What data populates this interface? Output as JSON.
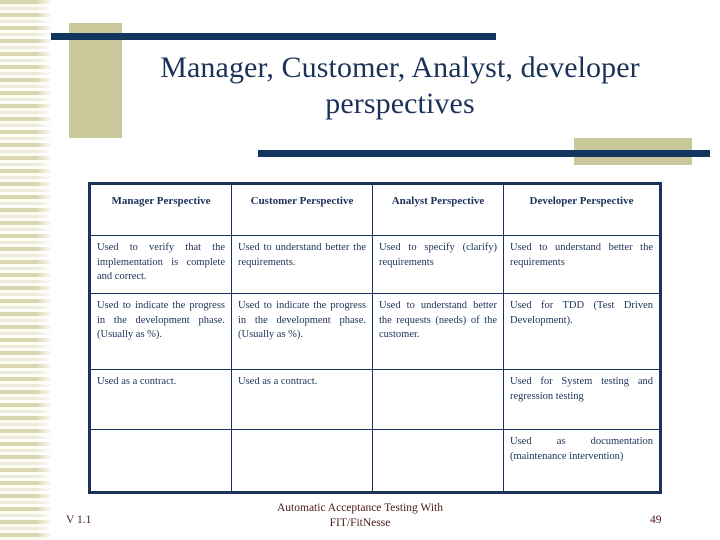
{
  "slide": {
    "title": "Manager, Customer, Analyst, developer perspectives",
    "colors": {
      "navy": "#1b3259",
      "navy_bar": "#12365f",
      "khaki": "#c8c89a",
      "footer_text": "#4a1b1b",
      "stripe_light": "#fffff4",
      "stripe_dark": "#d9d7b0"
    }
  },
  "table": {
    "headers": [
      "Manager Perspective",
      "Customer Perspective",
      "Analyst Perspective",
      "Developer Perspective"
    ],
    "rows": [
      [
        "Used to verify that the implementation is complete and correct.",
        "Used to understand better the requirements.",
        "Used to specify (clarify) requirements",
        "Used to understand better the requirements"
      ],
      [
        "Used to indicate the progress in the development phase. (Usually as %).",
        "Used to indicate the progress in the development phase. (Usually as %).",
        "Used to understand better the requests (needs) of the customer.",
        "Used for TDD (Test Driven Development)."
      ],
      [
        "Used as a contract.",
        "Used as a contract.",
        "",
        "Used for System testing and regression testing"
      ],
      [
        "",
        "",
        "",
        "Used as documentation (maintenance intervention)"
      ]
    ]
  },
  "footer": {
    "version": "V 1.1",
    "title_line1": "Automatic Acceptance Testing With",
    "title_line2": "FIT/FitNesse",
    "page_number": "49"
  }
}
